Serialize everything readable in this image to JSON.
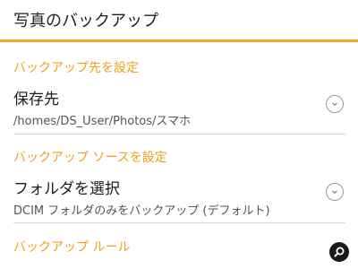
{
  "header": {
    "title": "写真のバックアップ"
  },
  "sections": [
    {
      "title": "バックアップ先を設定",
      "row": {
        "title": "保存先",
        "subtitle": "/homes/DS_User/Photos/スマホ",
        "icon": "chevron-down-icon"
      }
    },
    {
      "title": "バックアップ ソースを設定",
      "row": {
        "title": "フォルダを選択",
        "subtitle": "DCIM フォルダのみをバックアップ (デフォルト)",
        "icon": "chevron-down-icon"
      }
    },
    {
      "title": "バックアップ ルール"
    }
  ],
  "overlay": {
    "icon": "magnifier-icon"
  },
  "colors": {
    "accent": "#f5a623",
    "section_title": "#f0a01a",
    "divider": "#d9d9d9"
  }
}
